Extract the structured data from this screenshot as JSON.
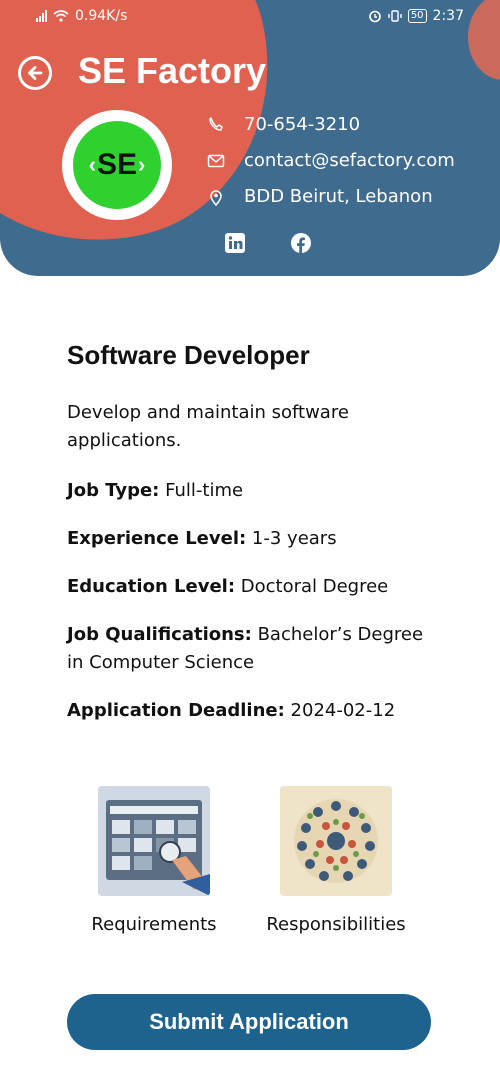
{
  "status_bar": {
    "network_speed": "0.94K/s",
    "battery": "50",
    "time": "2:37"
  },
  "header": {
    "title": "SE Factory",
    "logo_text": "SE",
    "phone": "70-654-3210",
    "email": "contact@sefactory.com",
    "address": "BDD Beirut, Lebanon",
    "colors": {
      "header_bg": "#3f6b8e",
      "blob": "#e0614f",
      "logo_green": "#2fd12f"
    }
  },
  "job": {
    "title": "Software Developer",
    "description": "Develop and maintain software applications.",
    "details": [
      {
        "label": "Job Type:",
        "value": " Full-time"
      },
      {
        "label": "Experience Level:",
        "value": " 1-3 years"
      },
      {
        "label": "Education Level:",
        "value": " Doctoral Degree"
      },
      {
        "label": "Job Qualifications:",
        "value": " Bachelor’s Degree in Computer Science"
      },
      {
        "label": "Application Deadline:",
        "value": " 2024-02-12"
      }
    ]
  },
  "cards": {
    "requirements": "Requirements",
    "responsibilities": "Responsibilities"
  },
  "actions": {
    "submit_label": "Submit Application",
    "submit_color": "#1e638e"
  }
}
